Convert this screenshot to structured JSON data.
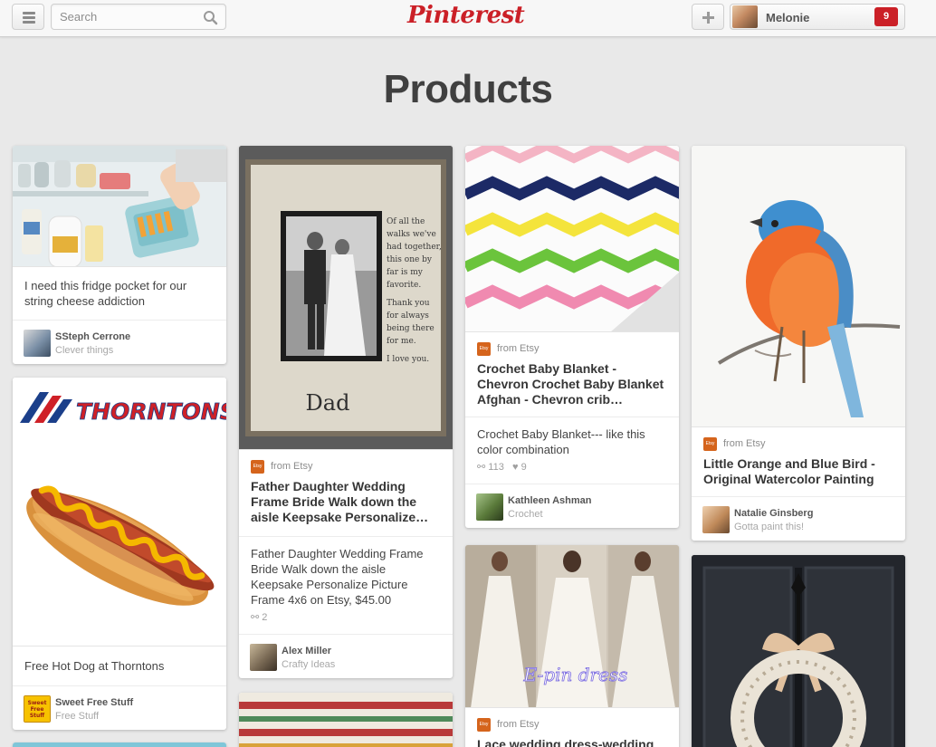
{
  "header": {
    "search_placeholder": "Search",
    "logo": "Pinterest",
    "user_name": "Melonie",
    "notification_count": "9",
    "brand_color": "#cb2027"
  },
  "page_title": "Products",
  "pins": [
    {
      "description": "I need this fridge pocket for our string cheese addiction",
      "pinner": "SSteph Cerrone",
      "board": "Clever things"
    },
    {
      "description": "Free Hot Dog at Thorntons",
      "image_text": "THORNTONS",
      "pinner": "Sweet Free Stuff",
      "board": "Free Stuff",
      "avatar_text": "Sweet Free Stuff"
    },
    {
      "source": "from Etsy",
      "title": "Father Daughter Wedding Frame Bride Walk down the aisle Keepsake Personalize…",
      "description": "Father Daughter Wedding Frame Bride Walk down the aisle Keepsake Personalize Picture Frame 4x6 on Etsy, $45.00",
      "repins": "2",
      "frame_caption": "Dad",
      "frame_poem": "Of all the walks we've had together, this one by far is my favorite. Thank you for always being there for me. I love you.",
      "pinner": "Alex Miller",
      "board": "Crafty Ideas"
    },
    {
      "source": "from Etsy",
      "title": "Crochet Baby Blanket - Chevron Crochet Baby Blanket Afghan - Chevron crib…",
      "description": "Crochet Baby Blanket--- like this color combination",
      "repins": "113",
      "likes": "9",
      "pinner": "Kathleen Ashman",
      "board": "Crochet"
    },
    {
      "image_text": "E-pin dress",
      "source": "from Etsy",
      "title": "Lace wedding dress-wedding"
    },
    {
      "source": "from Etsy",
      "title": "Little Orange and Blue Bird - Original Watercolor Painting",
      "pinner": "Natalie Ginsberg",
      "board": "Gotta paint this!"
    }
  ],
  "icons": {
    "etsy": "Etsy",
    "repin": "repin-icon",
    "like": "heart-icon"
  }
}
